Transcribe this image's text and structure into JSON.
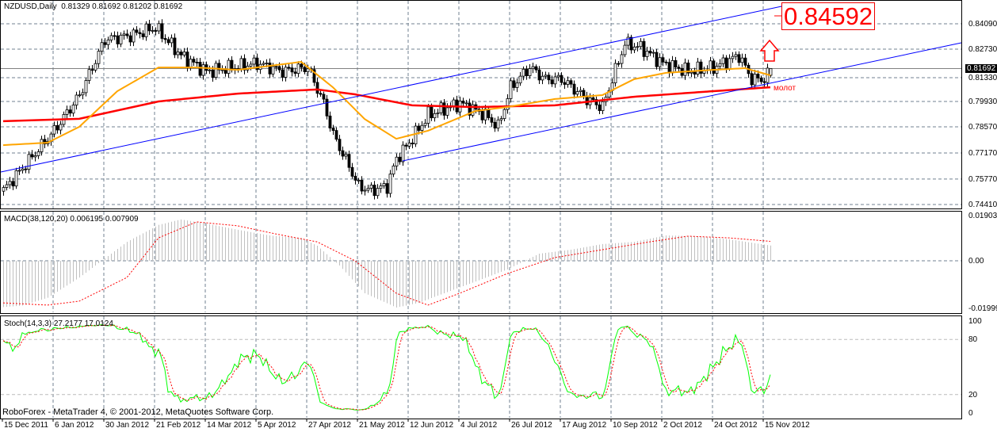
{
  "header": {
    "symbol": "NZDUSD,Daily",
    "ohlc": "0.81329 0.81692 0.81202 0.81692"
  },
  "annotations": {
    "target_price": "0.84592",
    "pattern_label": "молот",
    "last_price": "0.81692",
    "copyright": "RoboForex - MetaTrader 4, © 2001-2012, MetaQuotes Software Corp."
  },
  "colors": {
    "bull_candle": "#ffffff",
    "bear_candle": "#000000",
    "ma_fast": "#ffa500",
    "ma_slow": "#ff0000",
    "trendline": "#0000ff",
    "macd_hist": "#c0c0c0",
    "macd_signal": "#ff0000",
    "stoch_main": "#00ff00",
    "stoch_signal": "#ff0000",
    "grid": "#708090"
  },
  "chart_data": [
    {
      "type": "candlestick",
      "title": "NZDUSD,Daily",
      "ylim": [
        0.7441,
        0.8459
      ],
      "yticks": [
        "0.84090",
        "0.82730",
        "0.81330",
        "0.79930",
        "0.78570",
        "0.77170",
        "0.75770",
        "0.74410"
      ],
      "x_labels": [
        "15 Dec 2011",
        "6 Jan 2012",
        "30 Jan 2012",
        "21 Feb 2012",
        "14 Mar 2012",
        "5 Apr 2012",
        "27 Apr 2012",
        "21 May 2012",
        "12 Jun 2012",
        "4 Jul 2012",
        "26 Jul 2012",
        "17 Aug 2012",
        "10 Sep 2012",
        "2 Oct 2012",
        "24 Oct 2012",
        "15 Nov 2012"
      ],
      "bars_per_label": 16,
      "bar_count": 243,
      "close_keypoints": [
        [
          0,
          0.7517
        ],
        [
          16,
          0.7836
        ],
        [
          24,
          0.8027
        ],
        [
          32,
          0.8324
        ],
        [
          40,
          0.8345
        ],
        [
          48,
          0.8388
        ],
        [
          56,
          0.8239
        ],
        [
          64,
          0.8154
        ],
        [
          72,
          0.8175
        ],
        [
          80,
          0.8197
        ],
        [
          88,
          0.8154
        ],
        [
          96,
          0.8175
        ],
        [
          101,
          0.7984
        ],
        [
          104,
          0.7815
        ],
        [
          109,
          0.7645
        ],
        [
          112,
          0.7539
        ],
        [
          116,
          0.7517
        ],
        [
          121,
          0.7539
        ],
        [
          124,
          0.7687
        ],
        [
          128,
          0.7772
        ],
        [
          134,
          0.7921
        ],
        [
          144,
          0.7984
        ],
        [
          152,
          0.7921
        ],
        [
          156,
          0.7857
        ],
        [
          160,
          0.8069
        ],
        [
          166,
          0.8175
        ],
        [
          171,
          0.8112
        ],
        [
          176,
          0.8112
        ],
        [
          184,
          0.8006
        ],
        [
          189,
          0.7963
        ],
        [
          192,
          0.8112
        ],
        [
          196,
          0.8303
        ],
        [
          201,
          0.8282
        ],
        [
          208,
          0.8197
        ],
        [
          216,
          0.8154
        ],
        [
          224,
          0.8175
        ],
        [
          232,
          0.8239
        ],
        [
          236,
          0.8112
        ],
        [
          240,
          0.8112
        ],
        [
          242,
          0.8169
        ]
      ],
      "last_bar": {
        "open": 0.81329,
        "high": 0.81692,
        "low": 0.81202,
        "close": 0.81692
      },
      "ma_fast_keypoints": [
        [
          0,
          0.7759
        ],
        [
          14,
          0.7772
        ],
        [
          24,
          0.7857
        ],
        [
          36,
          0.8048
        ],
        [
          49,
          0.8175
        ],
        [
          61,
          0.8175
        ],
        [
          74,
          0.8162
        ],
        [
          94,
          0.8205
        ],
        [
          104,
          0.8069
        ],
        [
          114,
          0.7899
        ],
        [
          124,
          0.7793
        ],
        [
          134,
          0.7836
        ],
        [
          149,
          0.7942
        ],
        [
          159,
          0.7963
        ],
        [
          174,
          0.8006
        ],
        [
          189,
          0.8027
        ],
        [
          199,
          0.8112
        ],
        [
          209,
          0.8146
        ],
        [
          224,
          0.8162
        ],
        [
          234,
          0.8171
        ],
        [
          242,
          0.8133
        ]
      ],
      "ma_slow_keypoints": [
        [
          0,
          0.7887
        ],
        [
          24,
          0.79
        ],
        [
          49,
          0.7993
        ],
        [
          74,
          0.8035
        ],
        [
          99,
          0.8057
        ],
        [
          111,
          0.8031
        ],
        [
          129,
          0.7972
        ],
        [
          149,
          0.7963
        ],
        [
          174,
          0.7972
        ],
        [
          199,
          0.8018
        ],
        [
          224,
          0.8048
        ],
        [
          242,
          0.8069
        ]
      ]
    },
    {
      "type": "bar",
      "title": "MACD(38,120,20) 0.006195 0.007909",
      "ylim": [
        -0.01999,
        0.01903
      ],
      "yticks": [
        "0.01903",
        "0.00",
        "-0.01999"
      ],
      "hist_keypoints": [
        [
          0,
          -0.0188
        ],
        [
          6,
          -0.0182
        ],
        [
          14,
          -0.015
        ],
        [
          24,
          -0.0068
        ],
        [
          31,
          0
        ],
        [
          39,
          0.0077
        ],
        [
          49,
          0.0146
        ],
        [
          56,
          0.0168
        ],
        [
          64,
          0.0151
        ],
        [
          74,
          0.0126
        ],
        [
          84,
          0.0103
        ],
        [
          94,
          0.0093
        ],
        [
          99,
          0.0061
        ],
        [
          106,
          -0.0019
        ],
        [
          114,
          -0.0132
        ],
        [
          124,
          -0.019
        ],
        [
          131,
          -0.0171
        ],
        [
          139,
          -0.0132
        ],
        [
          149,
          -0.0084
        ],
        [
          159,
          -0.0035
        ],
        [
          169,
          0.0029
        ],
        [
          179,
          0.0045
        ],
        [
          189,
          0.0068
        ],
        [
          199,
          0.0077
        ],
        [
          209,
          0.0103
        ],
        [
          219,
          0.01
        ],
        [
          229,
          0.0087
        ],
        [
          242,
          0.0062
        ]
      ],
      "signal_keypoints": [
        [
          0,
          -0.0171
        ],
        [
          14,
          -0.018
        ],
        [
          24,
          -0.0164
        ],
        [
          39,
          -0.0068
        ],
        [
          49,
          0.0093
        ],
        [
          61,
          0.0158
        ],
        [
          74,
          0.0142
        ],
        [
          86,
          0.0109
        ],
        [
          99,
          0.0077
        ],
        [
          111,
          0
        ],
        [
          124,
          -0.0132
        ],
        [
          134,
          -0.018
        ],
        [
          144,
          -0.0132
        ],
        [
          159,
          -0.0052
        ],
        [
          174,
          0.0013
        ],
        [
          189,
          0.0045
        ],
        [
          204,
          0.0077
        ],
        [
          216,
          0.01
        ],
        [
          229,
          0.0093
        ],
        [
          242,
          0.0079
        ]
      ]
    },
    {
      "type": "line",
      "title": "Stoch(14,3,3) 27.2177 17.0124",
      "ylim": [
        0,
        100
      ],
      "yticks": [
        "100",
        "80",
        "20",
        "0"
      ],
      "params": {
        "k": 14,
        "slowing": 3,
        "d": 3
      }
    }
  ]
}
